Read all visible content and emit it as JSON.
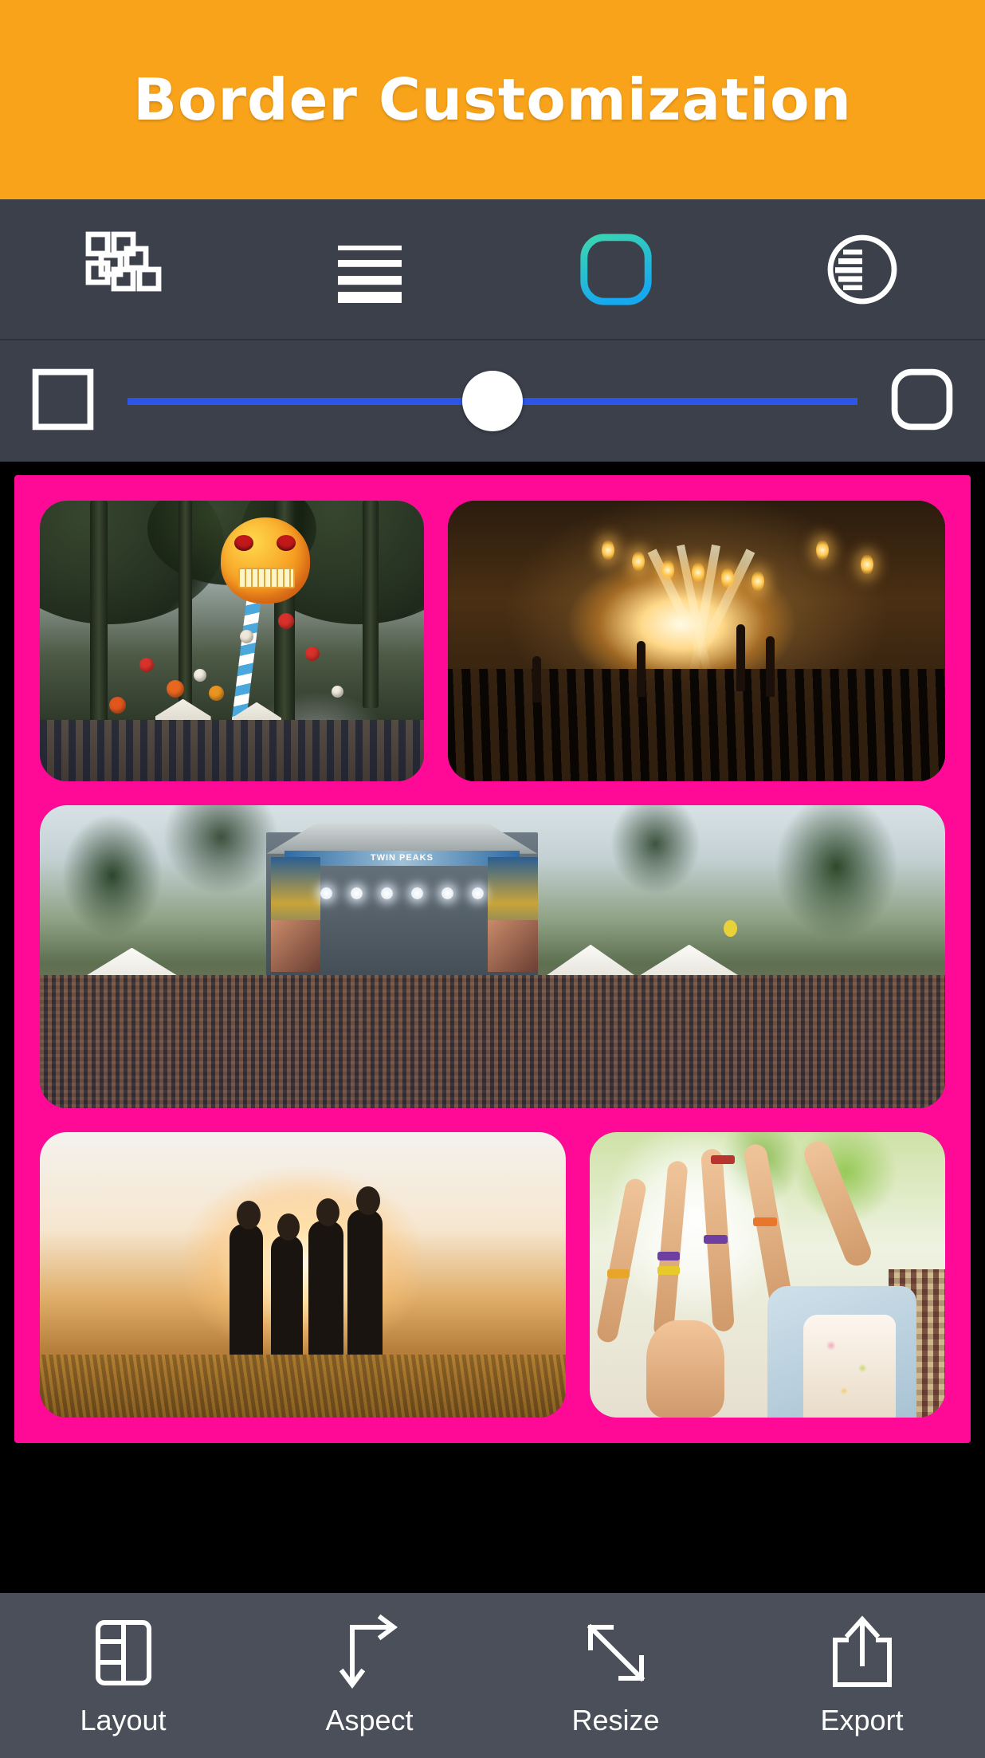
{
  "banner": {
    "title": "Border Customization",
    "bg_color": "#f9a31b",
    "text_color": "#ffffff"
  },
  "tool_tabs": {
    "items": [
      {
        "name": "collage-grid",
        "icon": "grid-collage-icon",
        "selected": false
      },
      {
        "name": "spacing-lines",
        "icon": "horizontal-lines-icon",
        "selected": false
      },
      {
        "name": "corner-radius",
        "icon": "rounded-square-icon",
        "selected": true
      },
      {
        "name": "shadow",
        "icon": "half-striped-circle-icon",
        "selected": false
      }
    ],
    "selected_index": 2,
    "bar_color": "#3b404b",
    "selected_color_start": "#3bd6b0",
    "selected_color_end": "#17a9ef"
  },
  "slider": {
    "name": "corner-radius-slider",
    "left_icon": "sharp-square-icon",
    "right_icon": "rounded-square-icon",
    "value_percent": 50,
    "track_color": "#2d55e8",
    "thumb_color": "#ffffff"
  },
  "collage": {
    "border_color": "#ff0a96",
    "canvas_bg": "#000000",
    "corner_radius_label": "rounded",
    "rows": [
      {
        "cells": [
          {
            "name": "photo-skull-balloon",
            "alt": "Orange skull balloon on striped pole above forest festival crowd"
          },
          {
            "name": "photo-night-concert",
            "alt": "Night concert stage with bright lights and crowd with raised hands"
          }
        ]
      },
      {
        "cells": [
          {
            "name": "photo-main-stage",
            "alt": "Daytime festival main stage with huge crowd, white tents and trees",
            "banner_text": "TWIN PEAKS"
          }
        ]
      },
      {
        "cells": [
          {
            "name": "photo-friends-sunset",
            "alt": "Four friends arm in arm watching sunset over hills"
          },
          {
            "name": "photo-cheering-fans",
            "alt": "Festival goers cheering with raised hands and wristbands"
          }
        ]
      }
    ]
  },
  "bottom_bar": {
    "bg_color": "#4a4f59",
    "items": [
      {
        "label": "Layout",
        "icon": "layout-panels-icon"
      },
      {
        "label": "Aspect",
        "icon": "aspect-arrow-icon"
      },
      {
        "label": "Resize",
        "icon": "diagonal-resize-icon"
      },
      {
        "label": "Export",
        "icon": "share-export-icon"
      }
    ]
  }
}
